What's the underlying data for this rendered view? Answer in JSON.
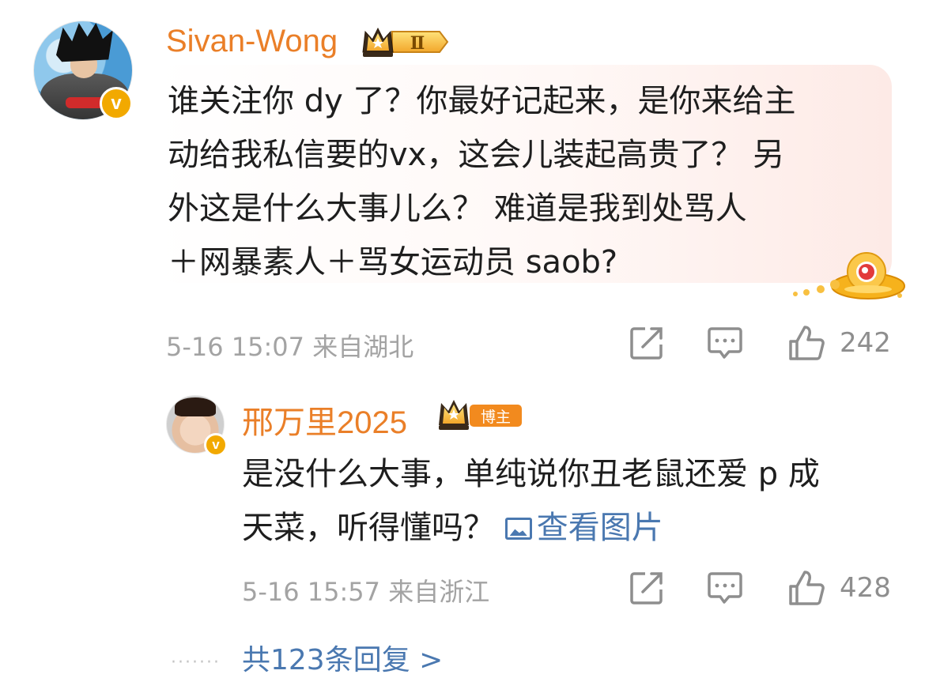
{
  "comment": {
    "username": "Sivan-Wong",
    "level_badge": "Ⅱ",
    "verified_badge": "v",
    "lines": [
      "谁关注你 dy 了？你最好记起来，是你来给主",
      "动给我私信要的vx，这会儿装起高贵了？ 另",
      "外这是什么大事儿么？ 难道是我到处骂人",
      "＋网暴素人＋骂女运动员 saob?"
    ],
    "timestamp": "5-16 15:07",
    "location": "来自湖北",
    "like_count": "242"
  },
  "reply": {
    "username": "邢万里2025",
    "author_badge": "博主",
    "verified_badge": "v",
    "line1": "是没什么大事，单纯说你丑老鼠还爱 p 成",
    "line2_text": "天菜，听得懂吗？ ",
    "view_image_label": "查看图片",
    "timestamp": "5-16 15:57",
    "location": "来自浙江",
    "like_count": "428"
  },
  "more_replies": {
    "dots": "·······",
    "label": "共123条回复 >"
  },
  "icons": {
    "forward": "share-icon",
    "comment": "comment-icon",
    "like": "thumbs-up-icon"
  },
  "colors": {
    "username": "#ea7f28",
    "link": "#4a78b0",
    "meta": "#a3a3a3",
    "verified": "#f2a900"
  }
}
